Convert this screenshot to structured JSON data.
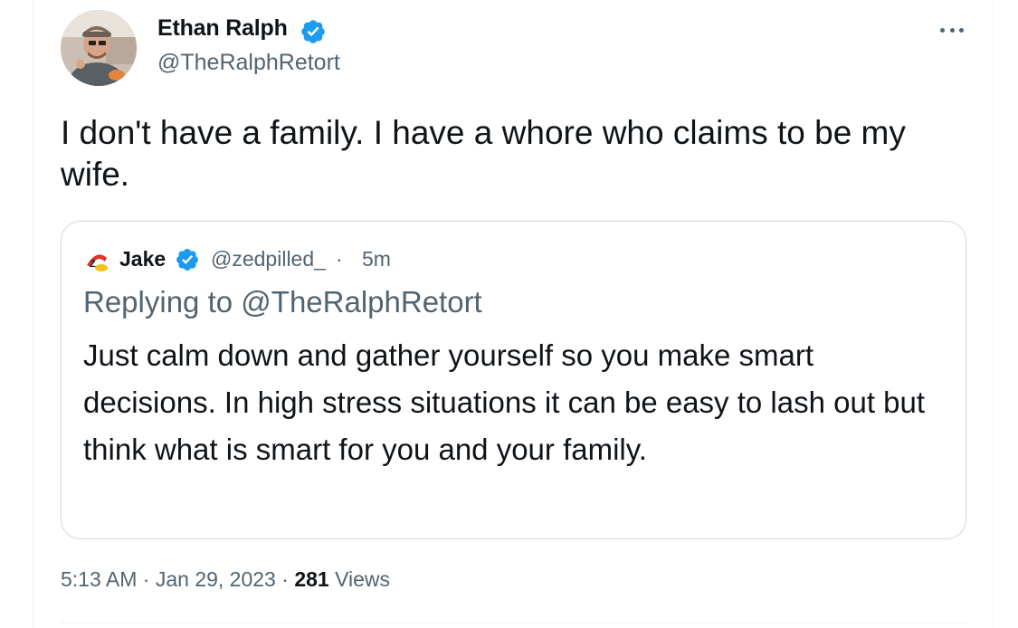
{
  "tweet": {
    "author": {
      "name": "Ethan Ralph",
      "handle": "@TheRalphRetort",
      "verified": true
    },
    "text": "I don't have a family. I have a whore who claims to be my wife.",
    "quoted_tweet": {
      "author_name": "Jake",
      "author_handle": "@zedpilled_",
      "separator": "·",
      "time": "5m",
      "verified": true,
      "replying_label": "Replying to",
      "replying_handle": "@TheRalphRetort",
      "text": "Just calm down and gather yourself so you make smart decisions. In high stress situations it can be easy to lash out but think what is smart for you and your family."
    },
    "meta": {
      "time": "5:13 AM",
      "sep1": " · ",
      "date": "Jan 29, 2023",
      "sep2": " · ",
      "views_count": "281",
      "views_label": " Views"
    }
  },
  "icons": {
    "verified": "verified-badge-icon",
    "more": "more-options-icon"
  },
  "colors": {
    "verified_blue": "#1d9bf0",
    "secondary_text": "#536471",
    "primary_text": "#0f1419",
    "border": "#cfd9de"
  }
}
